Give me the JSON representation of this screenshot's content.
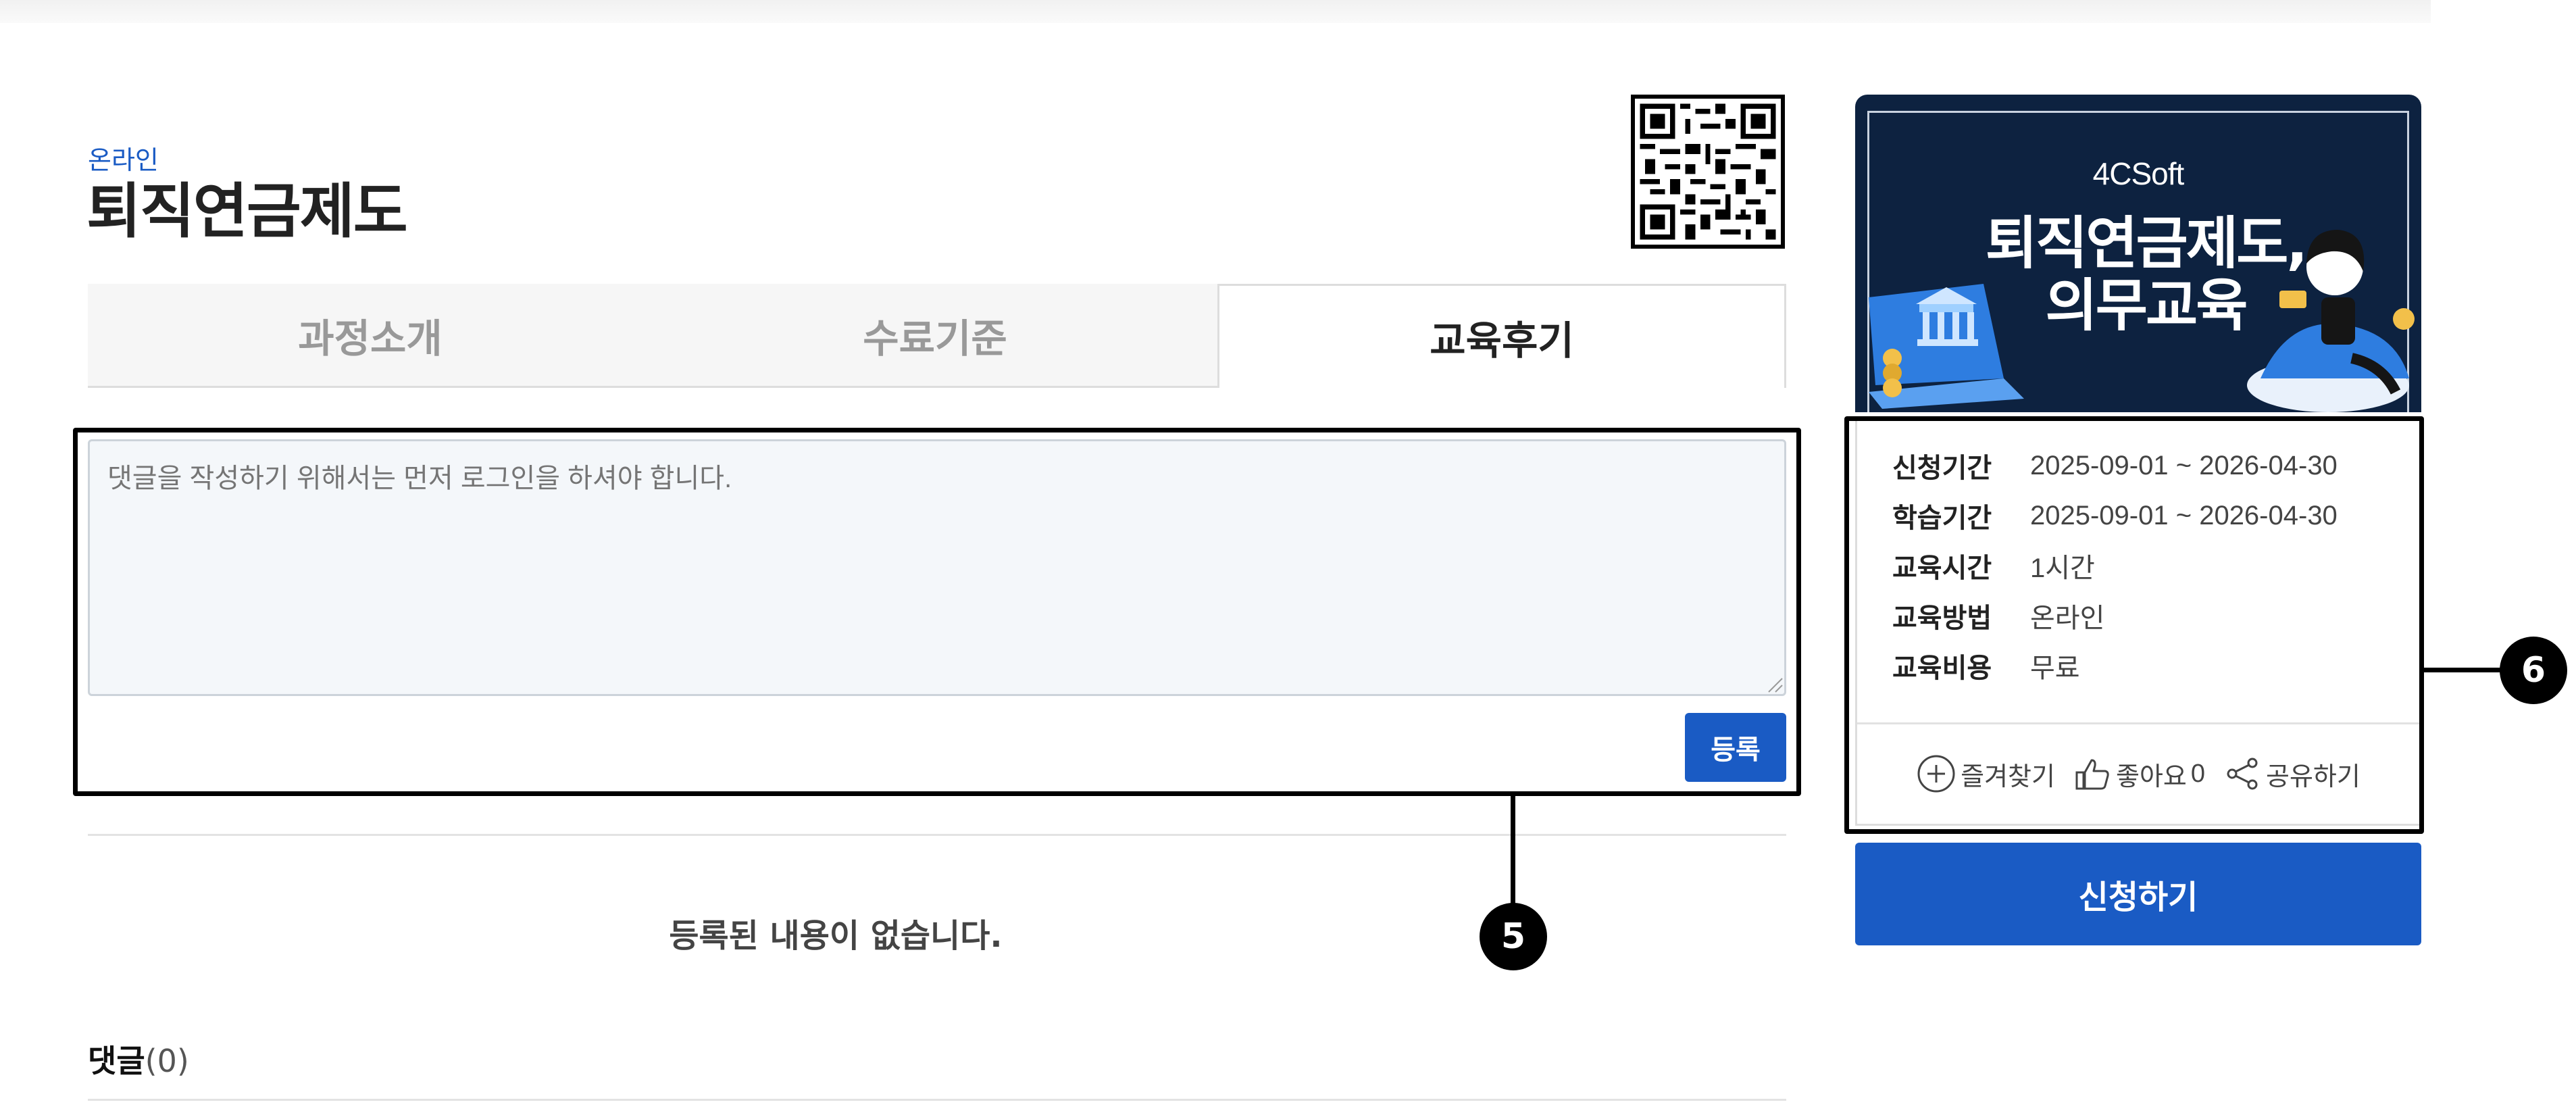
{
  "course": {
    "category": "온라인",
    "title": "퇴직연금제도"
  },
  "tabs": [
    {
      "label": "과정소개",
      "active": false
    },
    {
      "label": "수료기준",
      "active": false
    },
    {
      "label": "교육후기",
      "active": true
    }
  ],
  "review": {
    "placeholder": "댓글을 작성하기 위해서는 먼저 로그인을 하셔야 합니다.",
    "value": "",
    "submit_label": "등록",
    "empty_message": "등록된 내용이 없습니다.",
    "comments_label": "댓글",
    "comments_count": "(0)"
  },
  "banner": {
    "logo_text": "4CSoft",
    "title_line1": "퇴직연금제도,",
    "title_line2": "의무교육"
  },
  "info": {
    "rows": [
      {
        "label": "신청기간",
        "value": "2025-09-01 ~ 2026-04-30"
      },
      {
        "label": "학습기간",
        "value": "2025-09-01 ~ 2026-04-30"
      },
      {
        "label": "교육시간",
        "value": "1시간"
      },
      {
        "label": "교육방법",
        "value": "온라인"
      },
      {
        "label": "교육비용",
        "value": "무료"
      }
    ],
    "actions": {
      "bookmark_label": "즐겨찾기",
      "like_label": "좋아요",
      "like_count": "0",
      "share_label": "공유하기"
    }
  },
  "apply_label": "신청하기",
  "callouts": {
    "review_marker": "5",
    "info_marker": "6"
  },
  "colors": {
    "accent": "#1a5bc4",
    "banner_bg": "#0d2240",
    "callout": "#000000"
  }
}
